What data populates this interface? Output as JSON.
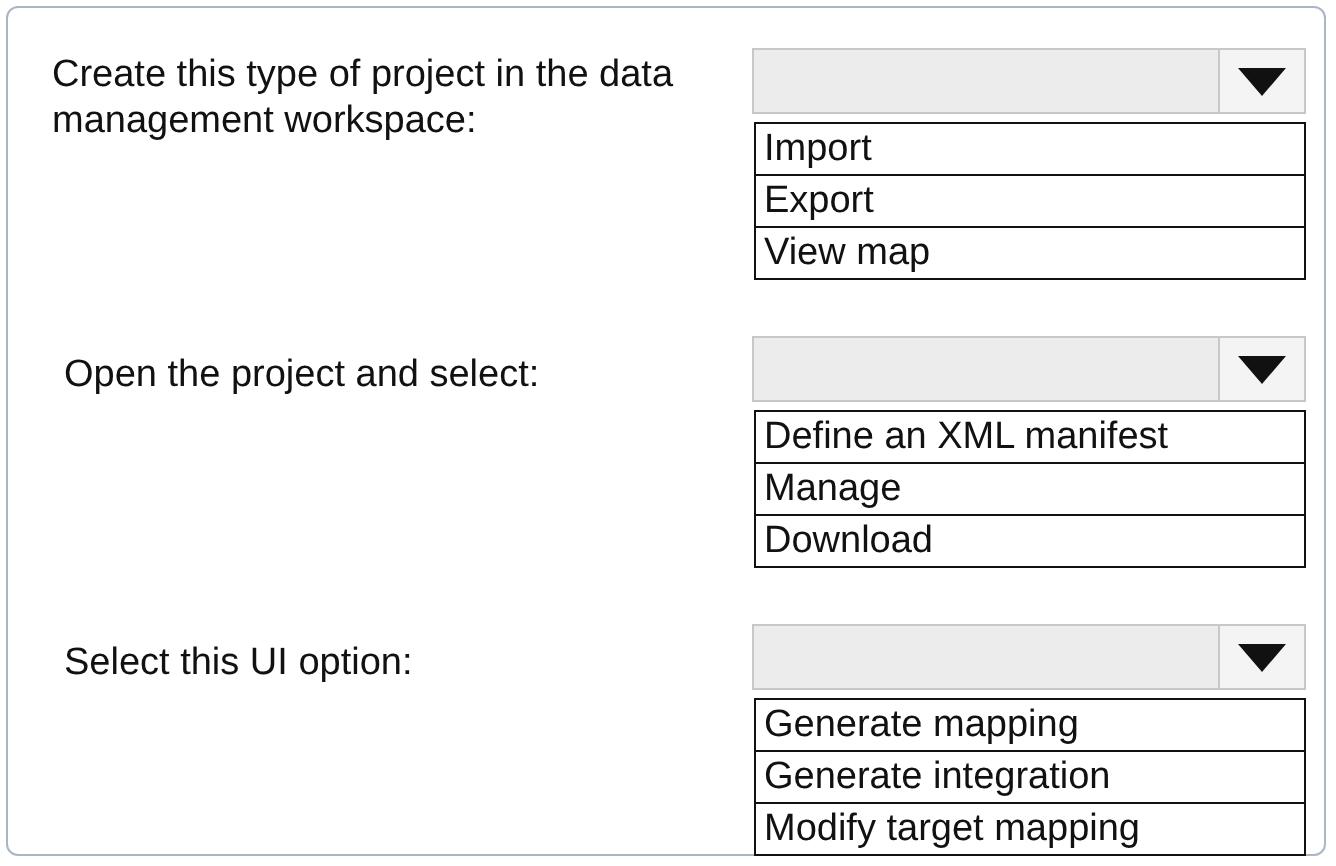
{
  "questions": [
    {
      "prompt": "Create this type of project in the data management workspace:",
      "options": [
        "Import",
        "Export",
        "View map"
      ]
    },
    {
      "prompt": "Open the project and select:",
      "options": [
        "Define an XML manifest",
        "Manage",
        "Download"
      ]
    },
    {
      "prompt": "Select this UI option:",
      "options": [
        "Generate mapping",
        "Generate integration",
        "Modify target mapping"
      ]
    }
  ]
}
